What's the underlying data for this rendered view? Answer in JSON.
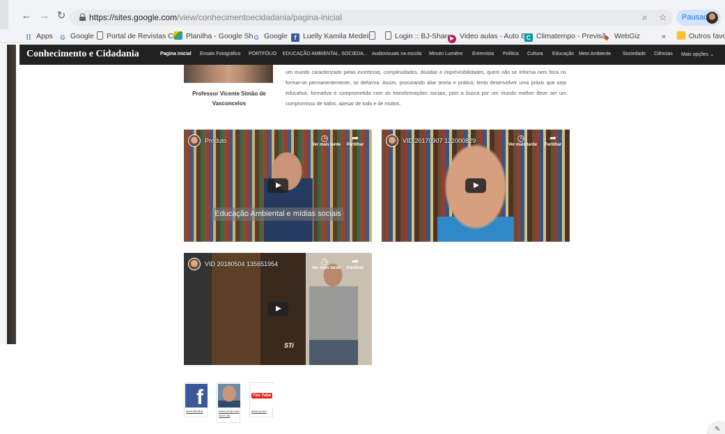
{
  "browser": {
    "url_host": "https://sites.google.com",
    "url_path": "/view/conhecimentoecidadania/pagina-inicial",
    "profile_label": "Pausada",
    "bookmarks": [
      {
        "label": "Apps",
        "icon": "apps-grid-icon"
      },
      {
        "label": "Google",
        "icon": "google-icon"
      },
      {
        "label": "Portal de Revistas Ci",
        "icon": "page-icon"
      },
      {
        "label": "Planilha - Google Sh",
        "icon": "drive-icon"
      },
      {
        "label": "Google",
        "icon": "google-icon"
      },
      {
        "label": "Luelly Kamila Medeir",
        "icon": "facebook-icon"
      },
      {
        "label": "",
        "icon": "page-icon"
      },
      {
        "label": "Login :: BJ-Share",
        "icon": "page-icon"
      },
      {
        "label": "Video aulas - Auto E",
        "icon": "play-circle-icon"
      },
      {
        "label": "Climatempo - Previsã",
        "icon": "climatempo-icon"
      },
      {
        "label": "WebGiz",
        "icon": "webgiz-icon"
      },
      {
        "label": "»",
        "icon": ""
      },
      {
        "label": "Outros favorit",
        "icon": "folder-icon"
      }
    ]
  },
  "site": {
    "title": "Conhecimento e Cidadania",
    "nav": [
      "Pagina inicial",
      "Ensaio Fotográfico",
      "PORTFÓLIO",
      "EDUCAÇÃO AMBIENTAL, SOCIEDA...",
      "Audiovisuais na escola",
      "Minuto Lumière",
      "Entrevista",
      "Política",
      "Cultura",
      "Educação",
      "Meio Ambiente",
      "Sociedade",
      "Ciências",
      "Mais opções ⌄"
    ]
  },
  "profile": {
    "name": "Professor Vicente Simão de Vasconcelos",
    "bio": "um mundo caracterizado pelas incertezas, complexidades, dúvidas e imprevisibilidades, quem não se informa nem foca no formar-se permanentemente, se deforma. Assim, procurando aliar teoria e prática, tento desenvolver uma práxis que seja educativa, formativa e comprometida com as transformações sociais, pois a busca por um mundo melhor deve ser um compromisso de todos, apesar de tudo e de muitos."
  },
  "videos": [
    {
      "title": "Produto",
      "caption": "Educação Ambiental e mídias sociais"
    },
    {
      "title": "VID 20170907 122000829",
      "caption": ""
    },
    {
      "title": "VID 20180504 135651954",
      "caption": ""
    }
  ],
  "video_actions": {
    "watch_later": "Ver mais tarde",
    "share": "Partilhar"
  },
  "overlay_text": "STi",
  "social": [
    {
      "label": "www.facebo",
      "icon": "facebook-icon"
    },
    {
      "label": "www.youtu www.yo utu",
      "icon": "avatar-icon"
    },
    {
      "label": "www.youtu",
      "icon": "youtube-icon",
      "logo_text": "You Tube"
    }
  ],
  "colors": {
    "header_bg": "#212121",
    "facebook": "#3b5998",
    "youtube": "#e62117"
  }
}
